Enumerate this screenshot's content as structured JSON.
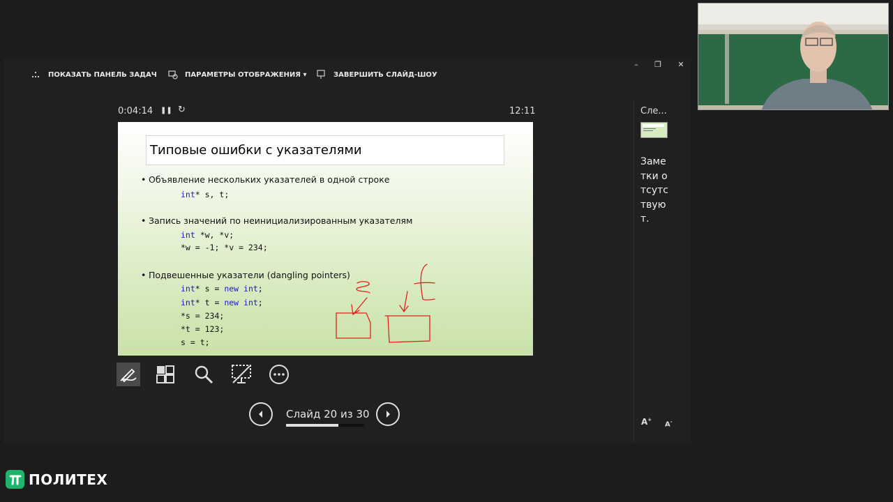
{
  "toolbar": {
    "show_taskbar": "ПОКАЗАТЬ ПАНЕЛЬ ЗАДАЧ",
    "display_settings": "ПАРАМЕТРЫ ОТОБРАЖЕНИЯ ▾",
    "end_slideshow": "ЗАВЕРШИТЬ СЛАЙД-ШОУ"
  },
  "window_controls": {
    "minimize": "–",
    "restore": "❐",
    "close": "✕"
  },
  "timer": {
    "elapsed": "0:04:14",
    "pause": "❚❚",
    "reset": "↻",
    "clock": "12:11"
  },
  "slide": {
    "title": "Типовые ошибки с указателями",
    "bullet1": "Объявление нескольких указателей в одной строке",
    "code1": {
      "kw": "int",
      "rest": "* s, t;"
    },
    "bullet2": "Запись значений по неинициализированным указателям",
    "code2": {
      "kw": "int",
      "rest": " *w, *v;",
      "line2": "*w = -1; *v = 234;"
    },
    "bullet3": "Подвешенные указатели (dangling pointers)",
    "code3": {
      "line1_kw": "int",
      "line1_mid": "* s = ",
      "line1_kw2": "new int",
      "line1_end": ";",
      "line2_kw": "int",
      "line2_mid": "* t = ",
      "line2_kw2": "new int",
      "line2_end": ";",
      "line3": "*s = 234;",
      "line4": "*t = 123;",
      "line5": "s = t;"
    }
  },
  "navigation": {
    "counter": "Слайд 20 из 30",
    "current": 20,
    "total": 30,
    "progress_fraction": 0.667
  },
  "side_panel": {
    "next_label": "Сле...",
    "notes": "Заметки отсутствуют.",
    "font_up": "A",
    "font_down": "A"
  },
  "logo": {
    "text": "ПОЛИТЕХ"
  },
  "colors": {
    "accent_green": "#21b26c",
    "code_keyword": "#1a1ac8",
    "ink": "#e0201c"
  }
}
